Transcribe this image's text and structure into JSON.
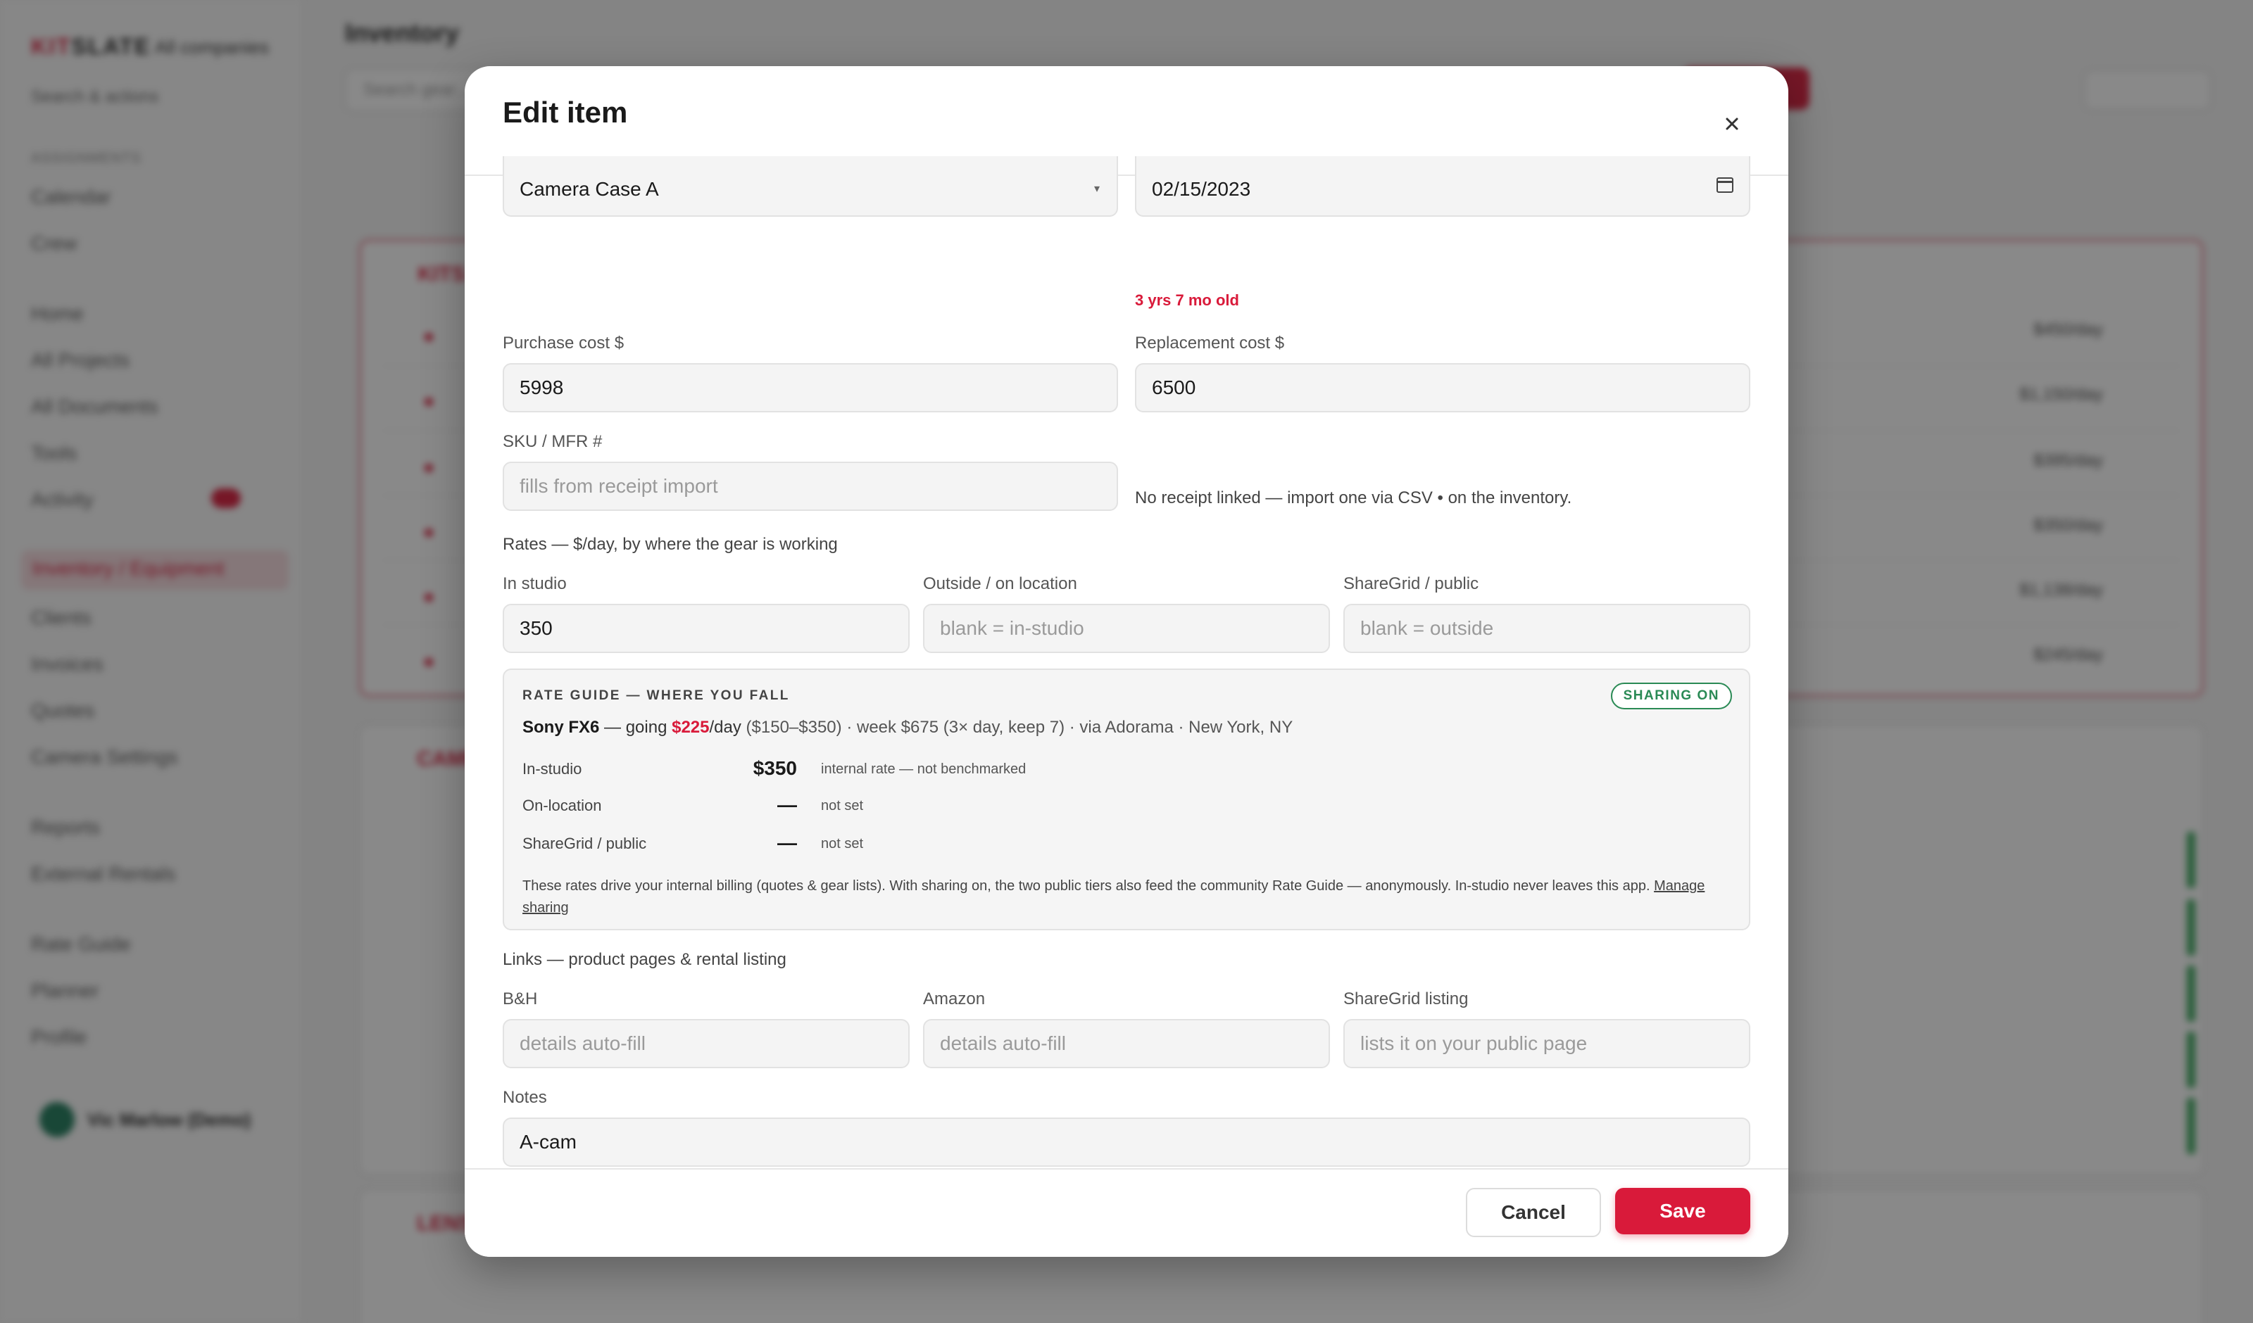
{
  "background": {
    "brand_left": "KIT",
    "brand_right": "SLATE",
    "brand_sub": "All companies",
    "sidebar_search": "Search & actions",
    "sidebar_group": "ASSIGNMENTS",
    "sidebar_items": [
      "Calendar",
      "Crew",
      "Home",
      "All Projects",
      "All Documents",
      "Tools",
      "Activity"
    ],
    "sidebar_active": "Inventory / Equipment",
    "sidebar_items_2": [
      "Clients",
      "Invoices",
      "Quotes",
      "Camera Settings",
      "Reports",
      "External Rentals",
      "Rate Guide",
      "Planner",
      "Profile"
    ],
    "user_name": "Vic Marlow (Demo)",
    "page_title": "Inventory",
    "search_placeholder": "Search gear…",
    "section_kits": "KITS",
    "section_cameras": "CAMERAS",
    "section_lenses": "LENSES",
    "kit_rates": [
      "$450/day",
      "$1,150/day",
      "$395/day",
      "$350/day",
      "$1,138/day",
      "$245/day"
    ]
  },
  "modal": {
    "title": "Edit item",
    "close_label": "×",
    "case_value": "Camera Case A",
    "purchase_date": "02/15/2023",
    "age_warning": "3 yrs 7 mo old",
    "purchase_cost_label": "Purchase cost $",
    "purchase_cost_value": "5998",
    "replacement_cost_label": "Replacement cost $",
    "replacement_cost_value": "6500",
    "sku_label": "SKU / MFR #",
    "sku_placeholder": "fills from receipt import",
    "receipt_note": "No receipt linked — import one via CSV • on the inventory.",
    "rates_label": "Rates — $/day, by where the gear is working",
    "in_studio_label": "In studio",
    "in_studio_value": "350",
    "outside_label": "Outside / on location",
    "outside_placeholder": "blank = in-studio",
    "sharegrid_label": "ShareGrid / public",
    "sharegrid_placeholder": "blank = outside",
    "guide": {
      "title": "RATE GUIDE — WHERE YOU FALL",
      "badge": "SHARING ON",
      "product": "Sony FX6",
      "going_prefix": "— going",
      "going_rate": "$225",
      "per_day": "/day",
      "range": "($150–$350)",
      "detail": "· week $675 (3× day, keep 7) · via Adorama · New York, NY",
      "rows": [
        {
          "label": "In-studio",
          "value": "$350",
          "note": "internal rate — not benchmarked"
        },
        {
          "label": "On-location",
          "value": "—",
          "note": "not set"
        },
        {
          "label": "ShareGrid / public",
          "value": "—",
          "note": "not set"
        }
      ],
      "footer": "These rates drive your internal billing (quotes & gear lists). With sharing on, the two public tiers also feed the community Rate Guide — anonymously. In-studio never leaves this app.",
      "manage_link": "Manage sharing"
    },
    "links_label": "Links — product pages & rental listing",
    "bh_label": "B&H",
    "bh_placeholder": "details auto-fill",
    "amazon_label": "Amazon",
    "amazon_placeholder": "details auto-fill",
    "sharegrid_listing_label": "ShareGrid listing",
    "sharegrid_listing_placeholder": "lists it on your public page",
    "notes_label": "Notes",
    "notes_value": "A-cam",
    "cancel_label": "Cancel",
    "save_label": "Save"
  },
  "colors": {
    "accent": "#d91a3a",
    "sharing_green": "#2a8a55"
  }
}
